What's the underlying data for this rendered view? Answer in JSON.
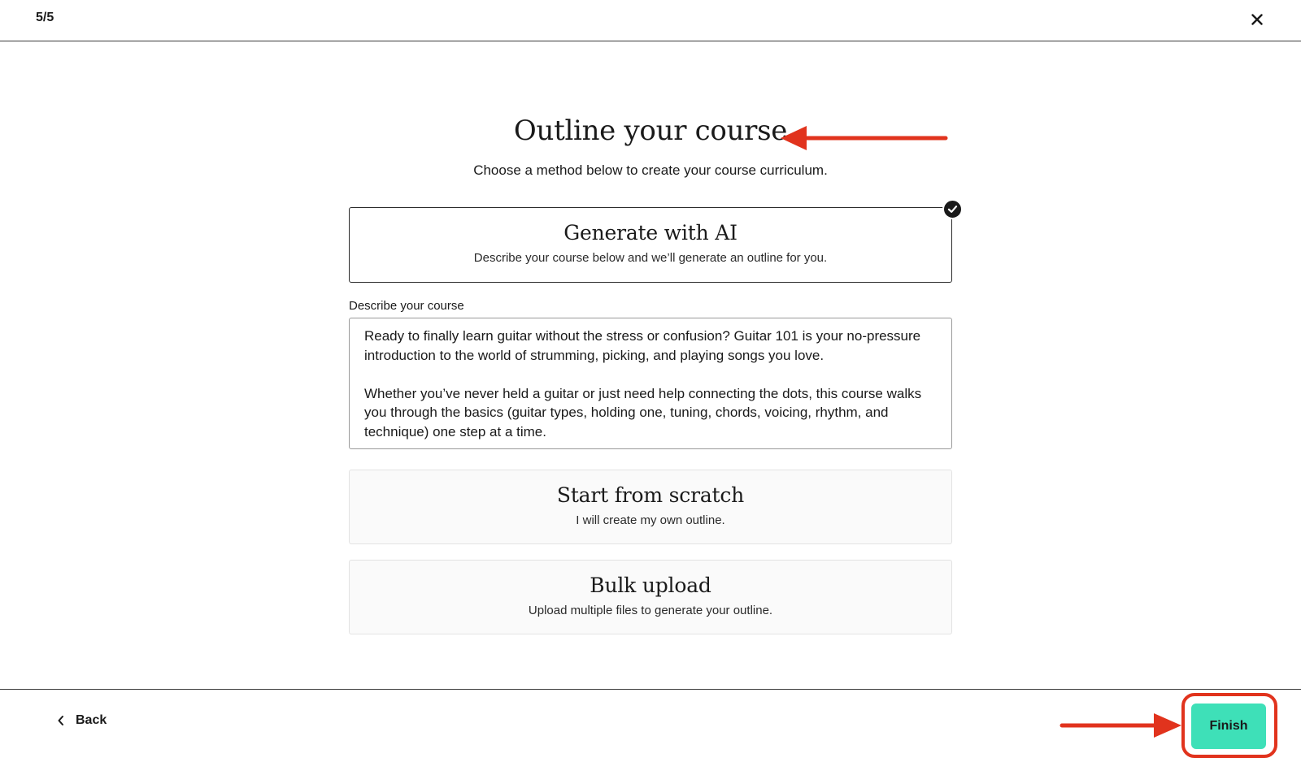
{
  "header": {
    "step_indicator": "5/5"
  },
  "main": {
    "title": "Outline your course",
    "subtitle": "Choose a method below to create your course curriculum."
  },
  "options": [
    {
      "title": "Generate with AI",
      "description": "Describe your course below and we’ll generate an outline for you.",
      "selected": true
    },
    {
      "title": "Start from scratch",
      "description": "I will create my own outline.",
      "selected": false
    },
    {
      "title": "Bulk upload",
      "description": "Upload multiple files to generate your outline.",
      "selected": false
    }
  ],
  "describe": {
    "label": "Describe your course",
    "value": "Ready to finally learn guitar without the stress or confusion? Guitar 101 is your no-pressure introduction to the world of strumming, picking, and playing songs you love.\n\nWhether you’ve never held a guitar or just need help connecting the dots, this course walks you through the basics (guitar types, holding one, tuning, chords, voicing, rhythm, and technique) one step at a time."
  },
  "footer": {
    "back_label": "Back",
    "finish_label": "Finish"
  },
  "colors": {
    "accent": "#3ee0b8",
    "annotation": "#e1331d",
    "text": "#1a1a1a"
  },
  "icons": {
    "close": "close-icon",
    "check": "check-icon",
    "back": "chevron-left-icon"
  }
}
